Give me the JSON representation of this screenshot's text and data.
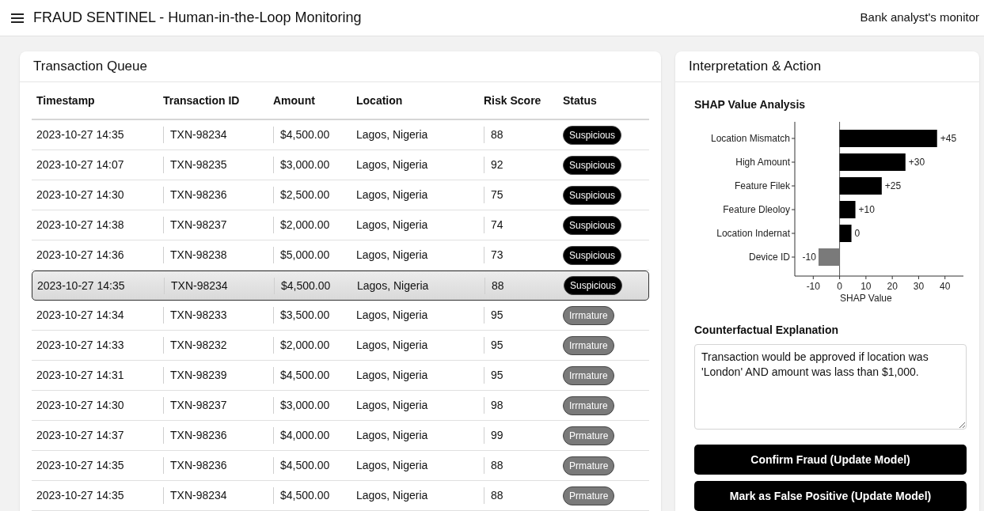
{
  "header": {
    "title": "FRAUD SENTINEL - Human-in-the-Loop Monitoring",
    "subtitle": "Bank analyst's monitor"
  },
  "queue": {
    "title": "Transaction Queue",
    "columns": [
      "Timestamp",
      "Transaction ID",
      "Amount",
      "Location",
      "Risk Score",
      "Status"
    ],
    "rows": [
      {
        "timestamp": "2023-10-27 14:35",
        "id": "TXN-98234",
        "amount": "$4,500.00",
        "location": "Lagos, Nigeria",
        "risk": "88",
        "status": "Suspicious",
        "color": "#000000",
        "selected": false
      },
      {
        "timestamp": "2023-10-27 14:07",
        "id": "TXN-98235",
        "amount": "$3,000.00",
        "location": "Lagos, Nigeria",
        "risk": "92",
        "status": "Suspicious",
        "color": "#000000",
        "selected": false
      },
      {
        "timestamp": "2023-10-27 14:30",
        "id": "TXN-98236",
        "amount": "$2,500.00",
        "location": "Lagos, Nigeria",
        "risk": "75",
        "status": "Suspicious",
        "color": "#000000",
        "selected": false
      },
      {
        "timestamp": "2023-10-27 14:38",
        "id": "TXN-98237",
        "amount": "$2,000.00",
        "location": "Lagos, Nigeria",
        "risk": "74",
        "status": "Suspicious",
        "color": "#000000",
        "selected": false
      },
      {
        "timestamp": "2023-10-27 14:36",
        "id": "TXN-98238",
        "amount": "$5,000.00",
        "location": "Lagos, Nigeria",
        "risk": "73",
        "status": "Suspicious",
        "color": "#000000",
        "selected": false
      },
      {
        "timestamp": "2023-10-27 14:35",
        "id": "TXN-98234",
        "amount": "$4,500.00",
        "location": "Lagos, Nigeria",
        "risk": "88",
        "status": "Suspicious",
        "color": "#000000",
        "selected": true
      },
      {
        "timestamp": "2023-10-27 14:34",
        "id": "TXN-98233",
        "amount": "$3,500.00",
        "location": "Lagos, Nigeria",
        "risk": "95",
        "status": "Irrmature",
        "color": "#7a7a7a",
        "selected": false
      },
      {
        "timestamp": "2023-10-27 14:33",
        "id": "TXN-98232",
        "amount": "$2,000.00",
        "location": "Lagos, Nigeria",
        "risk": "95",
        "status": "Irrmature",
        "color": "#7a7a7a",
        "selected": false
      },
      {
        "timestamp": "2023-10-27 14:31",
        "id": "TXN-98239",
        "amount": "$4,500.00",
        "location": "Lagos, Nigeria",
        "risk": "95",
        "status": "Irrmature",
        "color": "#7a7a7a",
        "selected": false
      },
      {
        "timestamp": "2023-10-27 14:30",
        "id": "TXN-98237",
        "amount": "$3,000.00",
        "location": "Lagos, Nigeria",
        "risk": "98",
        "status": "Irrmature",
        "color": "#7a7a7a",
        "selected": false
      },
      {
        "timestamp": "2023-10-27 14:37",
        "id": "TXN-98236",
        "amount": "$4,000.00",
        "location": "Lagos, Nigeria",
        "risk": "99",
        "status": "Prmature",
        "color": "#7a7a7a",
        "selected": false
      },
      {
        "timestamp": "2023-10-27 14:35",
        "id": "TXN-98236",
        "amount": "$4,500.00",
        "location": "Lagos, Nigeria",
        "risk": "88",
        "status": "Prmature",
        "color": "#7a7a7a",
        "selected": false
      },
      {
        "timestamp": "2023-10-27 14:35",
        "id": "TXN-98234",
        "amount": "$4,500.00",
        "location": "Lagos, Nigeria",
        "risk": "88",
        "status": "Prmature",
        "color": "#7a7a7a",
        "selected": false
      }
    ]
  },
  "interpretation": {
    "title": "Interpretation & Action",
    "shap": {
      "title": "SHAP Value Analysis",
      "chart_data": {
        "type": "bar",
        "orientation": "horizontal",
        "xlabel": "SHAP Value",
        "categories": [
          "Location Mismatch",
          "High Amount",
          "Feature Filek",
          "Feature Dleoloy",
          "Location Indernat",
          "Device ID"
        ],
        "series": [
          {
            "color": "#000000",
            "values": [
              37,
              25,
              16,
              6,
              4.5,
              null
            ]
          },
          {
            "color": "#7a7a7a",
            "values": [
              null,
              null,
              null,
              null,
              null,
              -8
            ]
          }
        ],
        "value_labels": [
          "+45",
          "+30",
          "+25",
          "+10",
          "0",
          "-10"
        ],
        "xlim": [
          -17,
          47
        ],
        "xticks": [
          -10,
          0,
          10,
          20,
          30,
          40
        ]
      }
    },
    "counterfactual": {
      "title": "Counterfactual Explanation",
      "value": "Transaction would be approved if location was 'London' AND amount was lass than $1,000."
    },
    "buttons": [
      "Confirm Fraud (Update Model)",
      "Mark as False Positive (Update Model)"
    ]
  }
}
